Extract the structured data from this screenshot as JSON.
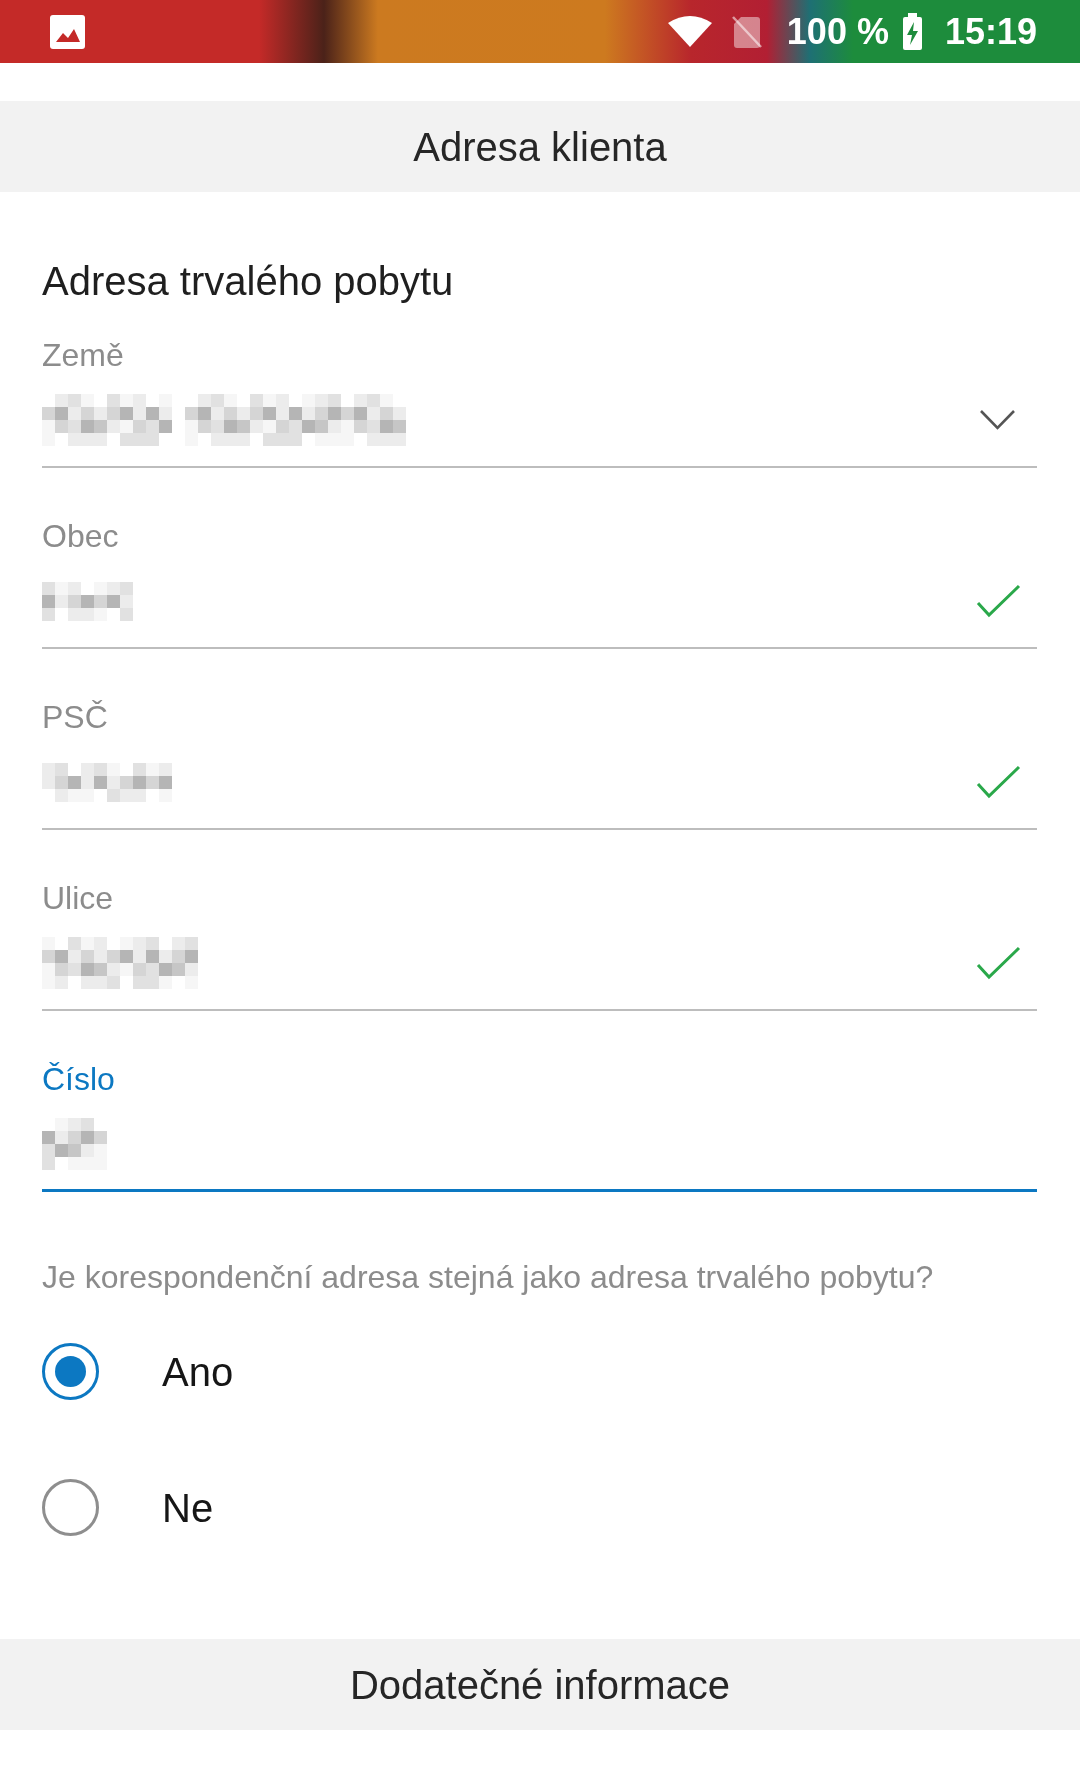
{
  "status_bar": {
    "battery": "100 %",
    "time": "15:19"
  },
  "header": {
    "title": "Adresa klienta"
  },
  "permanent_address": {
    "title": "Adresa trvalého pobytu",
    "fields": [
      {
        "label": "Země",
        "kind": "dropdown",
        "value_pixelated": true,
        "valid": false,
        "focused": false
      },
      {
        "label": "Obec",
        "kind": "text",
        "value_pixelated": true,
        "valid": true,
        "focused": false
      },
      {
        "label": "PSČ",
        "kind": "text",
        "value_pixelated": true,
        "valid": true,
        "focused": false
      },
      {
        "label": "Ulice",
        "kind": "text",
        "value_pixelated": true,
        "valid": true,
        "focused": false
      },
      {
        "label": "Číslo",
        "kind": "text",
        "value_pixelated": true,
        "valid": false,
        "focused": true
      }
    ]
  },
  "correspondence_question": {
    "text": "Je korespondenční adresa stejná jako adresa trvalého pobytu?",
    "options": [
      {
        "label": "Ano",
        "selected": true
      },
      {
        "label": "Ne",
        "selected": false
      }
    ]
  },
  "next_section": {
    "title": "Dodatečné informace"
  }
}
